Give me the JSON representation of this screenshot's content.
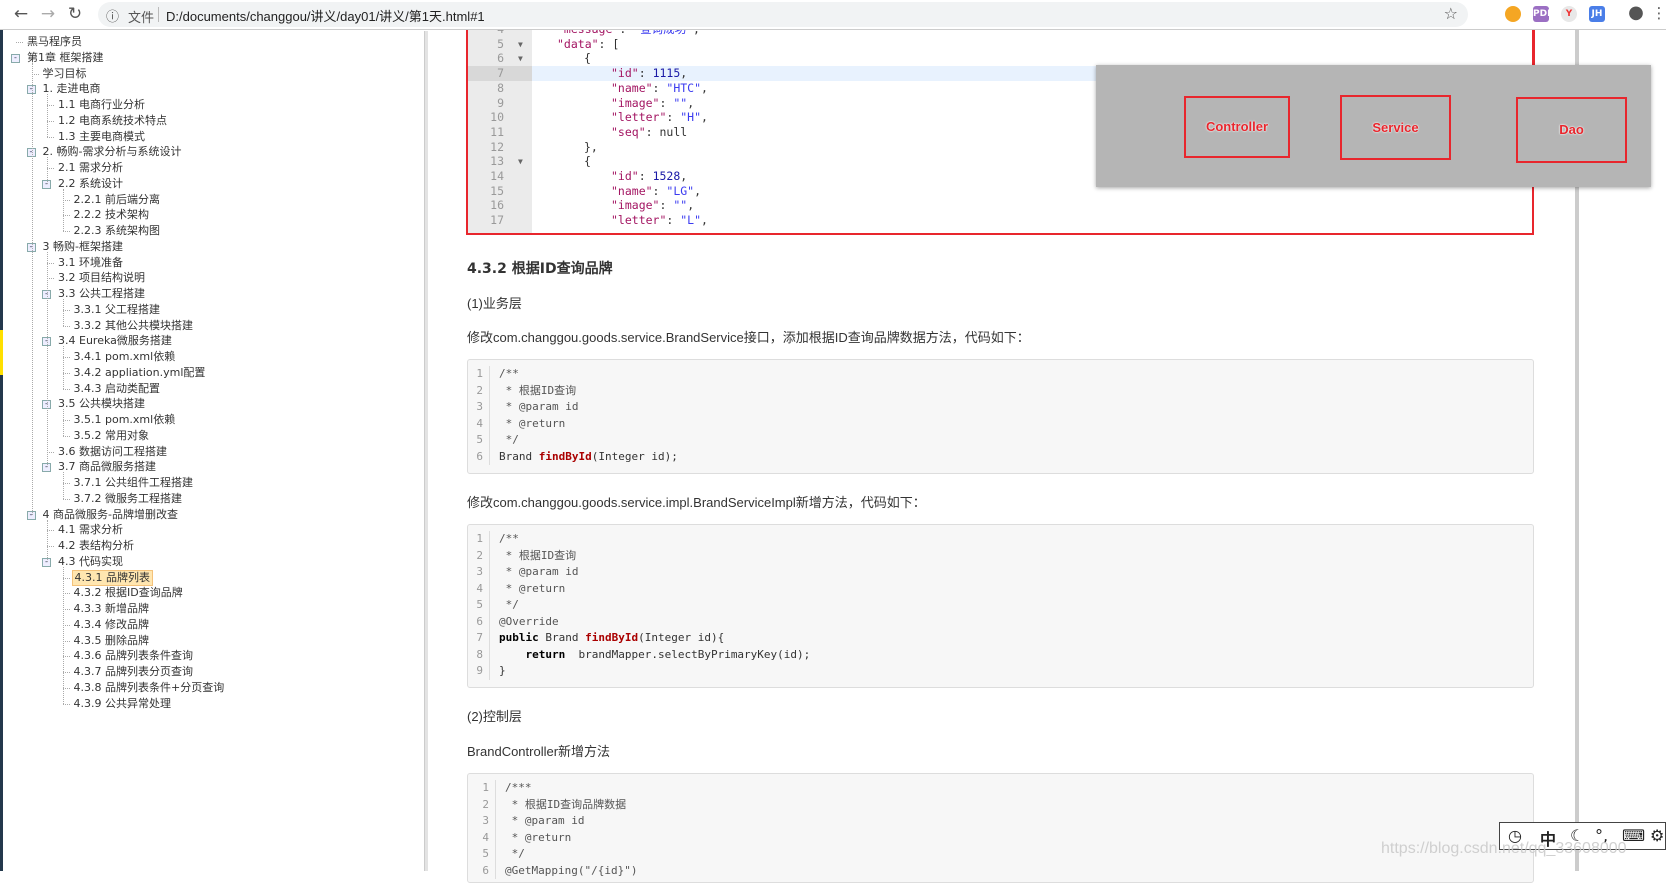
{
  "browser": {
    "back_icon": "arrow-left-icon",
    "forward_icon": "arrow-right-icon",
    "reload_icon": "reload-icon",
    "security_label": "文件",
    "url": "D:/documents/changgou/讲义/day01/讲义/第1天.html#1",
    "extensions": [
      {
        "name": "extension-1-icon",
        "color": "#f5a623",
        "text": ""
      },
      {
        "name": "pdf-extension-icon",
        "color": "#9b6fc3",
        "text": "PDF"
      },
      {
        "name": "yapi-extension-icon",
        "color": "#e8e8e8",
        "text": "Y"
      },
      {
        "name": "jh-extension-icon",
        "color": "#4a7ee8",
        "text": "JH"
      }
    ]
  },
  "tree": [
    {
      "level": 0,
      "label": "黑马程序员",
      "toggle": false
    },
    {
      "level": 0,
      "label": "第1章 框架搭建",
      "toggle": true
    },
    {
      "level": 1,
      "label": "学习目标",
      "toggle": false
    },
    {
      "level": 1,
      "label": "1. 走进电商",
      "toggle": true
    },
    {
      "level": 2,
      "label": "1.1 电商行业分析",
      "toggle": false
    },
    {
      "level": 2,
      "label": "1.2 电商系统技术特点",
      "toggle": false
    },
    {
      "level": 2,
      "label": "1.3 主要电商模式",
      "toggle": false
    },
    {
      "level": 1,
      "label": "2. 畅购-需求分析与系统设计",
      "toggle": true
    },
    {
      "level": 2,
      "label": "2.1 需求分析",
      "toggle": false
    },
    {
      "level": 2,
      "label": "2.2 系统设计",
      "toggle": true
    },
    {
      "level": 3,
      "label": "2.2.1 前后端分离",
      "toggle": false
    },
    {
      "level": 3,
      "label": "2.2.2 技术架构",
      "toggle": false
    },
    {
      "level": 3,
      "label": "2.2.3 系统架构图",
      "toggle": false
    },
    {
      "level": 1,
      "label": "3 畅购-框架搭建",
      "toggle": true
    },
    {
      "level": 2,
      "label": "3.1 环境准备",
      "toggle": false
    },
    {
      "level": 2,
      "label": "3.2 项目结构说明",
      "toggle": false
    },
    {
      "level": 2,
      "label": "3.3 公共工程搭建",
      "toggle": true
    },
    {
      "level": 3,
      "label": "3.3.1 父工程搭建",
      "toggle": false
    },
    {
      "level": 3,
      "label": "3.3.2 其他公共模块搭建",
      "toggle": false
    },
    {
      "level": 2,
      "label": "3.4 Eureka微服务搭建",
      "toggle": true
    },
    {
      "level": 3,
      "label": "3.4.1 pom.xml依赖",
      "toggle": false
    },
    {
      "level": 3,
      "label": "3.4.2 appliation.yml配置",
      "toggle": false
    },
    {
      "level": 3,
      "label": "3.4.3 启动类配置",
      "toggle": false
    },
    {
      "level": 2,
      "label": "3.5 公共模块搭建",
      "toggle": true
    },
    {
      "level": 3,
      "label": "3.5.1 pom.xml依赖",
      "toggle": false
    },
    {
      "level": 3,
      "label": "3.5.2 常用对象",
      "toggle": false
    },
    {
      "level": 2,
      "label": "3.6 数据访问工程搭建",
      "toggle": false
    },
    {
      "level": 2,
      "label": "3.7 商品微服务搭建",
      "toggle": true
    },
    {
      "level": 3,
      "label": "3.7.1 公共组件工程搭建",
      "toggle": false
    },
    {
      "level": 3,
      "label": "3.7.2 微服务工程搭建",
      "toggle": false
    },
    {
      "level": 1,
      "label": "4 商品微服务-品牌增删改查",
      "toggle": true
    },
    {
      "level": 2,
      "label": "4.1 需求分析",
      "toggle": false
    },
    {
      "level": 2,
      "label": "4.2 表结构分析",
      "toggle": false
    },
    {
      "level": 2,
      "label": "4.3 代码实现",
      "toggle": true
    },
    {
      "level": 3,
      "label": "4.3.1 品牌列表",
      "toggle": false,
      "selected": true
    },
    {
      "level": 3,
      "label": "4.3.2 根据ID查询品牌",
      "toggle": false
    },
    {
      "level": 3,
      "label": "4.3.3 新增品牌",
      "toggle": false
    },
    {
      "level": 3,
      "label": "4.3.4 修改品牌",
      "toggle": false
    },
    {
      "level": 3,
      "label": "4.3.5 删除品牌",
      "toggle": false
    },
    {
      "level": 3,
      "label": "4.3.6 品牌列表条件查询",
      "toggle": false
    },
    {
      "level": 3,
      "label": "4.3.7 品牌列表分页查询",
      "toggle": false
    },
    {
      "level": 3,
      "label": "4.3.8 品牌列表条件+分页查询",
      "toggle": false
    },
    {
      "level": 3,
      "label": "4.3.9 公共异常处理",
      "toggle": false
    }
  ],
  "json_response": {
    "lines": [
      {
        "n": "4",
        "fold": false,
        "indent": 1,
        "html": "<span class='k'>\"message\"</span>: <span class='s'>\"查询成功\"</span>,"
      },
      {
        "n": "5",
        "fold": true,
        "indent": 1,
        "html": "<span class='k'>\"data\"</span>: ["
      },
      {
        "n": "6",
        "fold": true,
        "indent": 2,
        "html": "{"
      },
      {
        "n": "7",
        "fold": false,
        "indent": 3,
        "html": "<span class='k'>\"id\"</span>: <span class='num'>1115</span>,",
        "highlight": true
      },
      {
        "n": "8",
        "fold": false,
        "indent": 3,
        "html": "<span class='k'>\"name\"</span>: <span class='s'>\"HTC\"</span>,"
      },
      {
        "n": "9",
        "fold": false,
        "indent": 3,
        "html": "<span class='k'>\"image\"</span>: <span class='s'>\"\"</span>,"
      },
      {
        "n": "10",
        "fold": false,
        "indent": 3,
        "html": "<span class='k'>\"letter\"</span>: <span class='s'>\"H\"</span>,"
      },
      {
        "n": "11",
        "fold": false,
        "indent": 3,
        "html": "<span class='k'>\"seq\"</span>: null"
      },
      {
        "n": "12",
        "fold": false,
        "indent": 2,
        "html": "},"
      },
      {
        "n": "13",
        "fold": true,
        "indent": 2,
        "html": "{"
      },
      {
        "n": "14",
        "fold": false,
        "indent": 3,
        "html": "<span class='k'>\"id\"</span>: <span class='num'>1528</span>,"
      },
      {
        "n": "15",
        "fold": false,
        "indent": 3,
        "html": "<span class='k'>\"name\"</span>: <span class='s'>\"LG\"</span>,"
      },
      {
        "n": "16",
        "fold": false,
        "indent": 3,
        "html": "<span class='k'>\"image\"</span>: <span class='s'>\"\"</span>,"
      },
      {
        "n": "17",
        "fold": false,
        "indent": 3,
        "html": "<span class='k'>\"letter\"</span>: <span class='s'>\"L\"</span>,"
      }
    ]
  },
  "diagram": {
    "boxes": [
      "Controller",
      "Service",
      "Dao"
    ],
    "color": "#e8262d"
  },
  "content": {
    "heading": "4.3.2 根据ID查询品牌",
    "service_layer": "(1)业务层",
    "service_desc": "修改com.changgou.goods.service.BrandService接口，添加根据ID查询品牌数据方法，代码如下：",
    "impl_desc": "修改com.changgou.goods.service.impl.BrandServiceImpl新增方法，代码如下：",
    "controller_layer": "(2)控制层",
    "controller_desc": "BrandController新增方法",
    "code_blocks": [
      [
        "<span class='cm'>/**</span>",
        "<span class='cm'> * 根据ID查询</span>",
        "<span class='cm'> * @param id</span>",
        "<span class='cm'> * @return</span>",
        "<span class='cm'> */</span>",
        "Brand <span class='fn'>findById</span>(Integer id);"
      ],
      [
        "<span class='cm'>/**</span>",
        "<span class='cm'> * 根据ID查询</span>",
        "<span class='cm'> * @param id</span>",
        "<span class='cm'> * @return</span>",
        "<span class='cm'> */</span>",
        "<span class='an'>@Override</span>",
        "<span class='kw'>public</span> Brand <span class='fn'>findById</span>(Integer id){",
        "    <span class='kw'>return</span>  brandMapper.selectByPrimaryKey(id);",
        "}"
      ],
      [
        "<span class='cm'>/***</span>",
        "<span class='cm'> * 根据ID查询品牌数据</span>",
        "<span class='cm'> * @param id</span>",
        "<span class='cm'> * @return</span>",
        "<span class='cm'> */</span>",
        "<span class='an'>@GetMapping(\"/{id}\")</span>"
      ]
    ]
  },
  "ime_toolbar": {
    "icons": [
      "ime-logo-icon",
      "chinese-mode-icon",
      "half-width-moon-icon",
      "punctuation-icon",
      "keyboard-icon",
      "settings-gear-icon"
    ],
    "mode_label": "中"
  },
  "watermark": "https://blog.csdn.net/qq_33608000"
}
